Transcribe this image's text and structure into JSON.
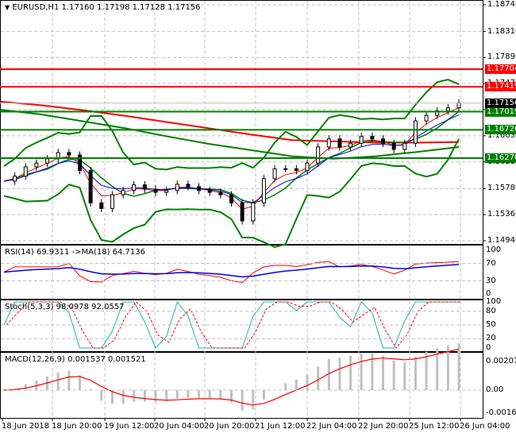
{
  "header": {
    "symbol": "EURUSD,H1",
    "open": "1.17160",
    "high": "1.17198",
    "low": "1.17128",
    "close": "1.17156"
  },
  "colors": {
    "resistance": "#ff0000",
    "support": "#008000",
    "current": "#000000",
    "rsi": "#ff0000",
    "rsi_ma": "#0000ff",
    "stoch_main": "#20b2aa",
    "stoch_signal": "#ff0000",
    "macd_hist": "#c0c0c0",
    "macd_signal": "#ff0000"
  },
  "chart_data": {
    "type": "candlestick",
    "price_ticks": [
      "1.18740",
      "1.18310",
      "1.17890",
      "1.17470",
      "1.17050",
      "1.16630",
      "1.16210",
      "1.15780",
      "1.15360",
      "1.14940"
    ],
    "ylim": [
      1.1494,
      1.1874
    ],
    "time_ticks": [
      "18 Jun 2018",
      "18 Jun 20:00",
      "19 Jun 12:00",
      "20 Jun 04:00",
      "20 Jun 20:00",
      "21 Jun 12:00",
      "22 Jun 04:00",
      "22 Jun 20:00",
      "25 Jun 12:00",
      "26 Jun 04:00"
    ],
    "close": [
      1.159,
      1.1598,
      1.1613,
      1.1619,
      1.1626,
      1.1636,
      1.1632,
      1.1607,
      1.1555,
      1.1546,
      1.1568,
      1.1575,
      1.1584,
      1.1577,
      1.1572,
      1.1575,
      1.1585,
      1.1581,
      1.1575,
      1.1572,
      1.1568,
      1.1555,
      1.1526,
      1.1555,
      1.1594,
      1.161,
      1.161,
      1.1607,
      1.1619,
      1.1645,
      1.1658,
      1.1645,
      1.1651,
      1.1662,
      1.1658,
      1.1651,
      1.1641,
      1.1651,
      1.1687,
      1.1696,
      1.1703,
      1.1708,
      1.1716
    ],
    "ma_red": [
      1.1718,
      1.1712,
      1.1704,
      1.1695,
      1.1685,
      1.1675,
      1.1665,
      1.1656,
      1.1654,
      1.1652,
      1.1652,
      1.1653
    ],
    "ma_green": [
      1.1705,
      1.1697,
      1.1686,
      1.1675,
      1.1662,
      1.165,
      1.164,
      1.163,
      1.1626,
      1.163,
      1.1637,
      1.1645
    ],
    "levels": [
      {
        "price": "1.17704",
        "type": "resistance"
      },
      {
        "price": "1.17419",
        "type": "resistance"
      },
      {
        "price": "1.17019",
        "type": "support"
      },
      {
        "price": "1.16726",
        "type": "support"
      },
      {
        "price": "1.16270",
        "type": "support"
      }
    ],
    "current_price": "1.17156",
    "rsi": {
      "label": "RSI(14) 69.9311  ->MA(18) 64.7136",
      "ticks": [
        "100",
        "70",
        "30",
        "0"
      ]
    },
    "stoch": {
      "label": "Stoch(5,3,3) 98.0978 92.0557",
      "ticks": [
        "100",
        "80",
        "50",
        "20",
        "0"
      ]
    },
    "macd": {
      "label": "MACD(12,26,9) 0.001537 0.001521",
      "ticks": [
        "0.002077",
        "0.00",
        "-0.001699"
      ]
    }
  }
}
